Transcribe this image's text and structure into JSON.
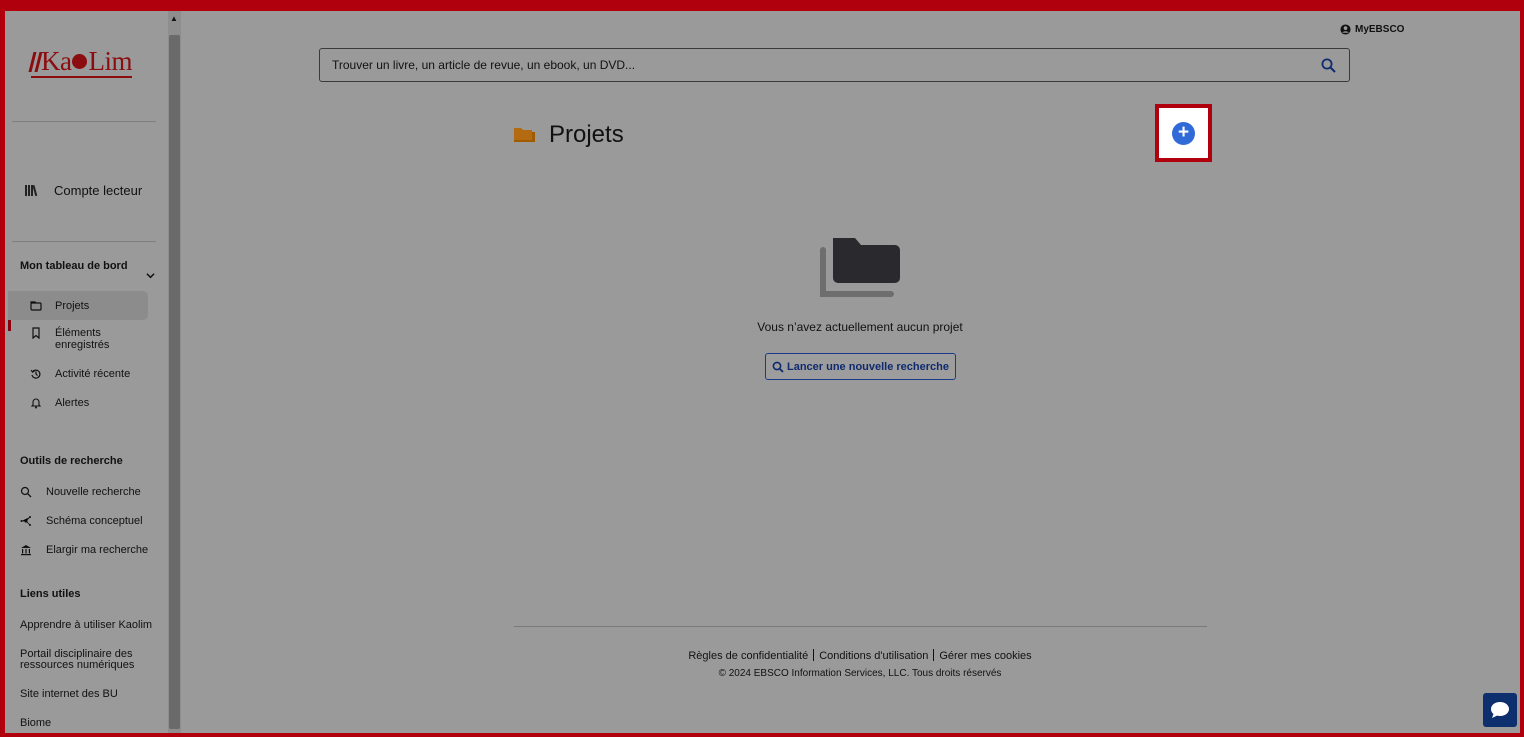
{
  "sidebar": {
    "logo_text": "KaoLim",
    "account_label": "Compte lecteur",
    "dashboard_title": "Mon tableau de bord",
    "dashboard_items": [
      {
        "label": "Projets",
        "icon": "projects-icon",
        "active": true
      },
      {
        "label": "Éléments enregistrés",
        "icon": "bookmark-icon"
      },
      {
        "label": "Activité récente",
        "icon": "history-icon"
      },
      {
        "label": "Alertes",
        "icon": "bell-icon"
      }
    ],
    "tools_title": "Outils de recherche",
    "tools": [
      {
        "label": "Nouvelle recherche",
        "icon": "search-icon"
      },
      {
        "label": "Schéma conceptuel",
        "icon": "concept-map-icon"
      },
      {
        "label": "Elargir ma recherche",
        "icon": "institution-icon"
      }
    ],
    "links_title": "Liens utiles",
    "links": [
      "Apprendre à utiliser Kaolim",
      "Portail disciplinaire des ressources numériques",
      "Site internet des BU",
      "Biome"
    ]
  },
  "header": {
    "myebsco_label": "MyEBSCO",
    "search_placeholder": "Trouver un livre, un article de revue, un ebook, un DVD..."
  },
  "main": {
    "title": "Projets",
    "add_button_symbol": "+",
    "empty_message": "Vous n’avez actuellement aucun projet",
    "launch_button": "Lancer une nouvelle recherche"
  },
  "footer": {
    "privacy": "Règles de confidentialité",
    "terms": "Conditions d'utilisation",
    "cookies": "Gérer mes cookies",
    "copyright": "© 2024 EBSCO Information Services, LLC. Tous droits réservés"
  },
  "colors": {
    "brand": "#8b0d10",
    "accent": "#2f6ad8",
    "highlight_border": "#b0000e",
    "overlay_bg": "#9a9a9a"
  }
}
